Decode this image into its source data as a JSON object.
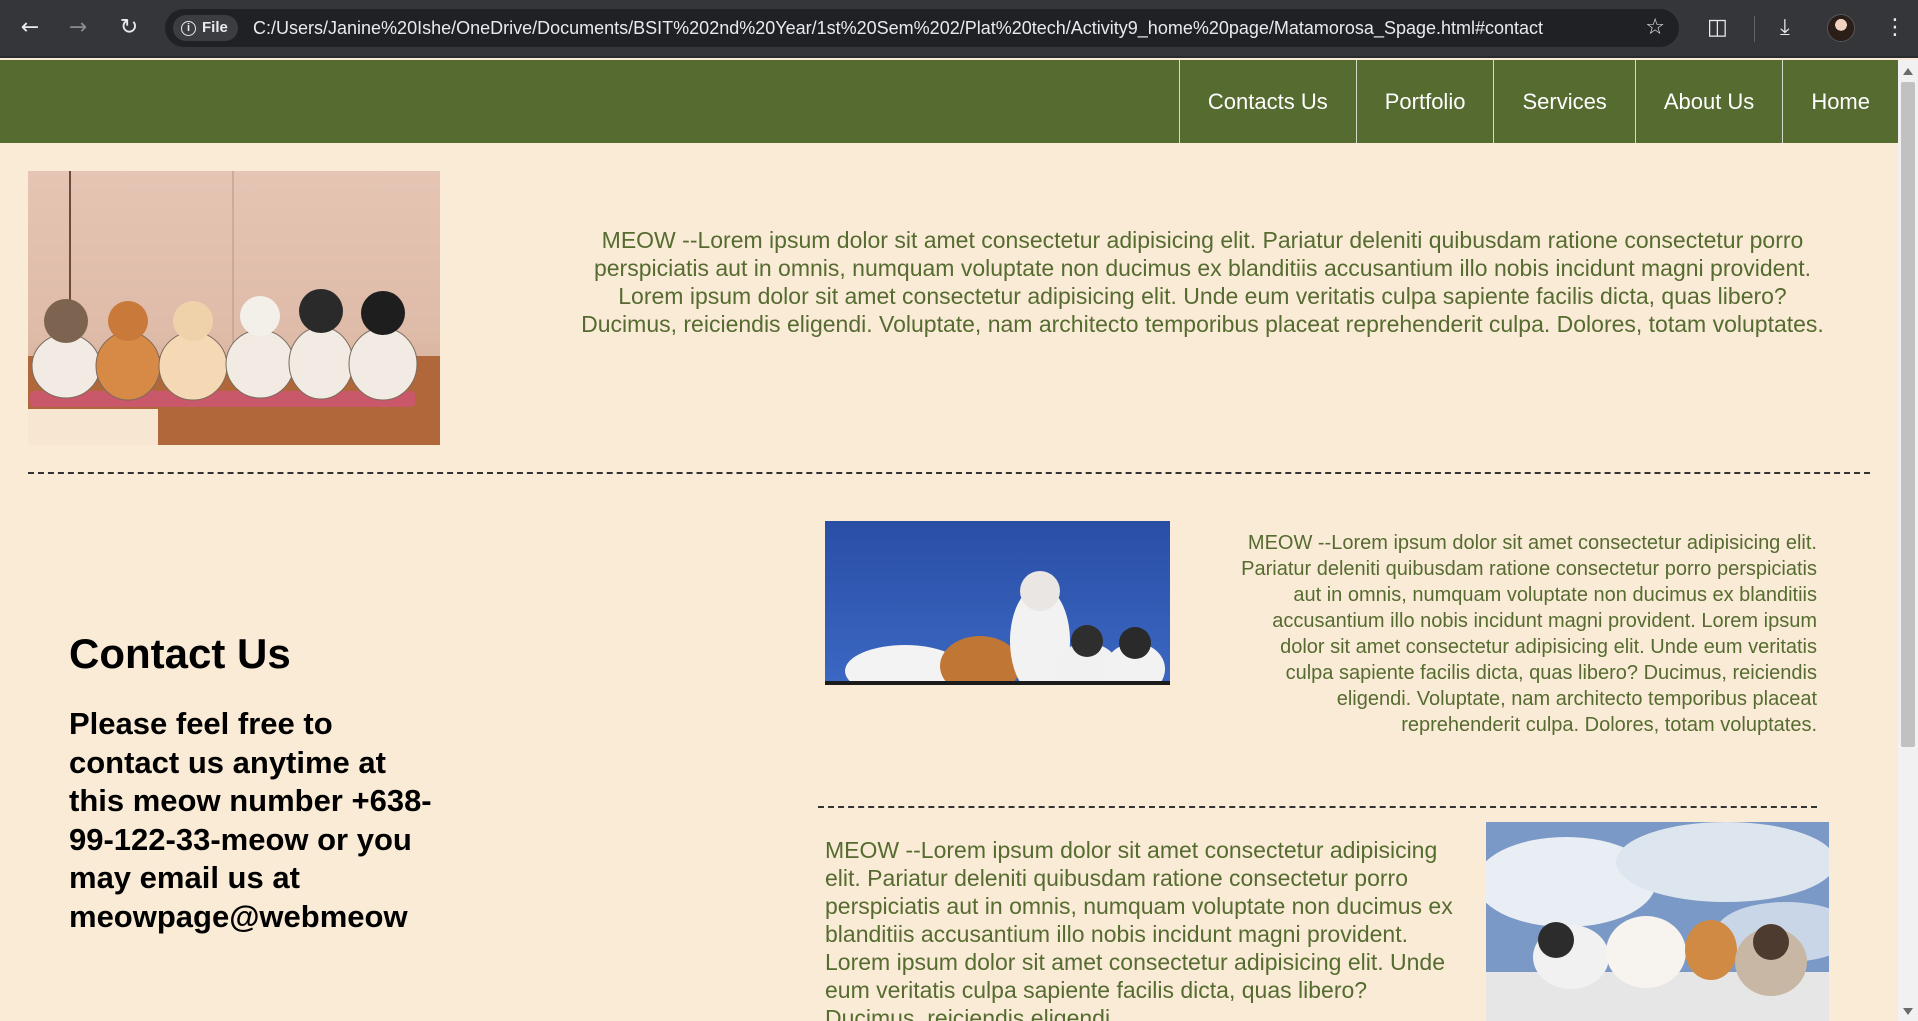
{
  "browser": {
    "chip_label": "File",
    "url": "C:/Users/Janine%20Ishe/OneDrive/Documents/BSIT%202nd%20Year/1st%20Sem%202/Plat%20tech/Activity9_home%20page/Matamorosa_Spage.html#contact",
    "icons": [
      "back-icon",
      "forward-icon",
      "reload-icon",
      "info-icon",
      "star-icon",
      "extensions-icon",
      "download-icon",
      "profile-avatar",
      "menu-icon"
    ]
  },
  "nav": {
    "items": [
      "Contacts Us",
      "Portfolio",
      "Services",
      "About Us",
      "Home"
    ],
    "bg_color": "#556b2f"
  },
  "intro": {
    "text": "MEOW --Lorem ipsum dolor sit amet consectetur adipisicing elit. Pariatur deleniti quibusdam ratione consectetur porro perspiciatis aut in omnis, numquam voluptate non ducimus ex blanditiis accusantium illo nobis incidunt magni provident. Lorem ipsum dolor sit amet consectetur adipisicing elit. Unde eum veritatis culpa sapiente facilis dicta, quas libero? Ducimus, reiciendis eligendi. Voluptate, nam architecto temporibus placeat reprehenderit culpa. Dolores, totam voluptates."
  },
  "contact": {
    "title": "Contact Us",
    "body": "Please feel free to contact us anytime at this meow number +638-99-122-33-meow or you may email us at meowpage@webmeow"
  },
  "block_right": {
    "text": "MEOW --Lorem ipsum dolor sit amet consectetur adipisicing elit. Pariatur deleniti quibusdam ratione consectetur porro perspiciatis aut in omnis, numquam voluptate non ducimus ex blanditiis accusantium illo nobis incidunt magni provident. Lorem ipsum dolor sit amet consectetur adipisicing elit. Unde eum veritatis culpa sapiente facilis dicta, quas libero? Ducimus, reiciendis eligendi. Voluptate, nam architecto temporibus placeat reprehenderit culpa. Dolores, totam voluptates."
  },
  "block_bottom": {
    "text": "MEOW --Lorem ipsum dolor sit amet consectetur adipisicing elit. Pariatur deleniti quibusdam ratione consectetur porro perspiciatis aut in omnis, numquam voluptate non ducimus ex blanditiis accusantium illo nobis incidunt magni provident. Lorem ipsum dolor sit amet consectetur adipisicing elit. Unde eum veritatis culpa sapiente facilis dicta, quas libero? Ducimus, reiciendis eligendi."
  },
  "colors": {
    "page_bg": "#faebd7",
    "text_green": "#556b2f"
  }
}
